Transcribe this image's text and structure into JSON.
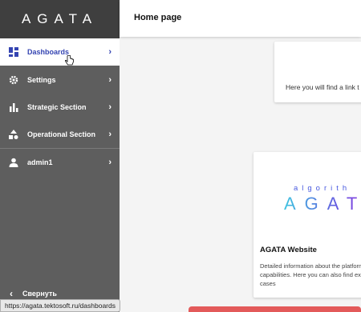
{
  "sidebar": {
    "logo": "AGATA",
    "items": [
      {
        "label": "Dashboards",
        "icon": "dashboard-icon"
      },
      {
        "label": "Settings",
        "icon": "gear-icon"
      },
      {
        "label": "Strategic Section",
        "icon": "bar-chart-icon"
      },
      {
        "label": "Operational Section",
        "icon": "shapes-icon"
      },
      {
        "label": "admin1",
        "icon": "person-icon"
      }
    ],
    "collapse_label": "Свернуть"
  },
  "header": {
    "title": "Home page"
  },
  "cards": {
    "link_card_text": "Here you will find a link t",
    "website_card": {
      "logo_top": "algorith",
      "logo_main": "AGATA",
      "title": "AGATA Website",
      "description": "Detailed information about the platform capabilities. Here you can also find exa cases"
    }
  },
  "status_url": "https://agata.tektosoft.ru/dashboards",
  "colors": {
    "accent": "#3545b2",
    "sidebar": "#5e5e5e",
    "logo_bg": "#3f3f3f",
    "alert": "#e35a5a"
  }
}
